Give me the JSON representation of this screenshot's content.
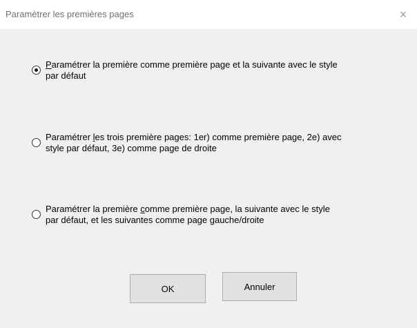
{
  "window": {
    "title": "Paramètrer les premières pages",
    "close_glyph": "×"
  },
  "options": [
    {
      "text_pre": "",
      "mnemonic": "P",
      "text_post": "aramétrer la première comme première page et la suivante avec le style",
      "line2": "par défaut",
      "checked": true
    },
    {
      "text_pre": "Paramétrer ",
      "mnemonic": "l",
      "text_post": "es trois première pages: 1er) comme première page, 2e) avec",
      "line2": "style par défaut, 3e) comme page de droite",
      "checked": false
    },
    {
      "text_pre": "Paramétrer la première ",
      "mnemonic": "c",
      "text_post": "omme première page, la suivante avec le style",
      "line2": "par défaut, et les suivantes comme page gauche/droite",
      "checked": false
    }
  ],
  "buttons": {
    "ok": "OK",
    "cancel": "Annuler"
  }
}
